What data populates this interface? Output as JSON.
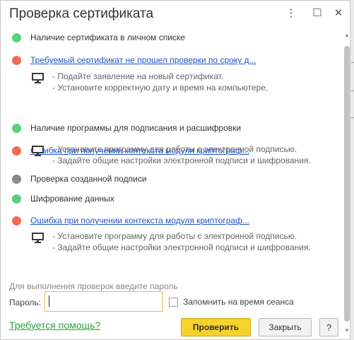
{
  "window": {
    "title": "Проверка сертификата",
    "menu_icon": "⋮",
    "maximize_icon": "☐",
    "close_icon": "✕"
  },
  "checks": [
    {
      "status": "green",
      "text": "Наличие сертификата в личном списке",
      "is_link": false
    },
    {
      "status": "red",
      "text": "Требуемый сертификат не прошел проверки по сроку д...",
      "is_link": true,
      "advice": [
        "- Подайте заявление на новый сертификат.",
        "- Установите корректную дату и время на компьютере."
      ]
    },
    {
      "status": "green",
      "text": "Наличие программы для подписания и расшифровки",
      "is_link": false
    },
    {
      "status": "red",
      "text": "Ошибка при получении контекста модуля криптограф...",
      "is_link": true,
      "advice": [
        "- Установите программу для работы с электронной подписью.",
        "- Задайте общие настройки электронной подписи и шифрования."
      ]
    },
    {
      "status": "gray",
      "text": "Проверка созданной подписи",
      "is_link": false
    },
    {
      "status": "green",
      "text": "Шифрование данных",
      "is_link": false
    },
    {
      "status": "red",
      "text": "Ошибка при получении контекста модуля криптограф...",
      "is_link": true,
      "advice": [
        "- Установите программу для работы с электронной подписью.",
        "- Задайте общие настройки электронной подписи и шифрования."
      ]
    }
  ],
  "form": {
    "hint": "Для выполнения проверок введите пароль",
    "password_label": "Пароль:",
    "password_value": "",
    "remember_label": "Запомнить на время сеанса",
    "remember_checked": false
  },
  "footer": {
    "help_link": "Требуется помощь?",
    "check_button": "Проверить",
    "close_button": "Закрыть",
    "help_button": "?"
  },
  "colors": {
    "status_green": "#5dcf7e",
    "status_red": "#ef6b53",
    "status_gray": "#8a8a8a",
    "link": "#2253c6",
    "help_link": "#2f9e3f",
    "primary_button": "#f7d22c",
    "input_focus_border": "#e8c33a"
  },
  "icons": {
    "advice_icon": "monitor-icon",
    "scroll_up": "▲",
    "scroll_down": "▼"
  }
}
